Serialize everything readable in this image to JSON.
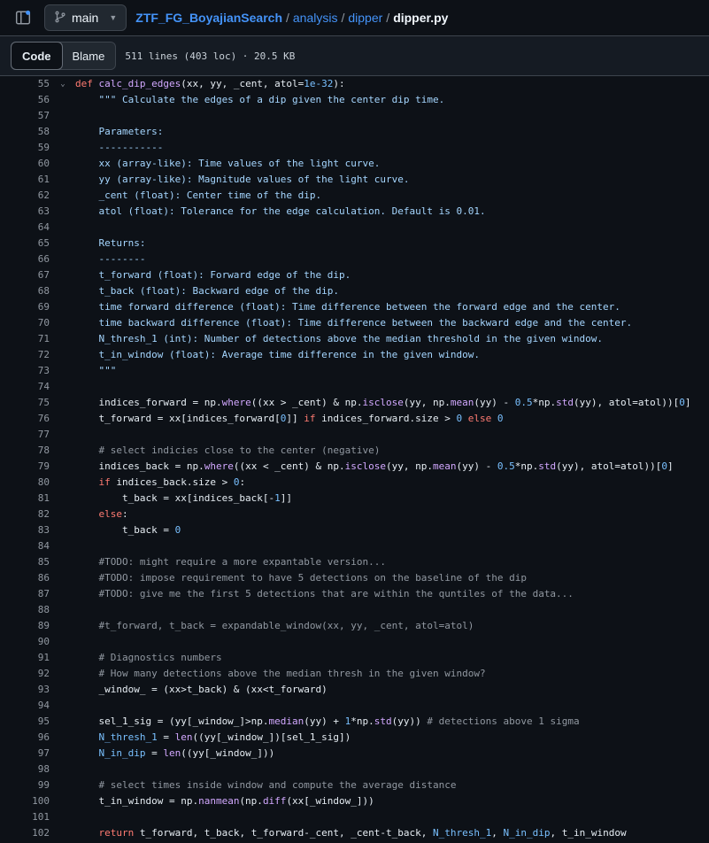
{
  "header": {
    "branch": "main",
    "repo": "ZTF_FG_BoyajianSearch",
    "path": [
      "analysis",
      "dipper"
    ],
    "file": "dipper.py"
  },
  "toolbar": {
    "code_tab": "Code",
    "blame_tab": "Blame",
    "file_info": "511 lines (403 loc) · 20.5 KB"
  },
  "code_lines": [
    {
      "n": "55",
      "t": "def calc_dip_edges(xx, yy, _cent, atol=1e-32):",
      "fold": true
    },
    {
      "n": "56",
      "t": "    \"\"\" Calculate the edges of a dip given the center dip time."
    },
    {
      "n": "57",
      "t": ""
    },
    {
      "n": "58",
      "t": "    Parameters:"
    },
    {
      "n": "59",
      "t": "    -----------"
    },
    {
      "n": "60",
      "t": "    xx (array-like): Time values of the light curve."
    },
    {
      "n": "61",
      "t": "    yy (array-like): Magnitude values of the light curve."
    },
    {
      "n": "62",
      "t": "    _cent (float): Center time of the dip."
    },
    {
      "n": "63",
      "t": "    atol (float): Tolerance for the edge calculation. Default is 0.01."
    },
    {
      "n": "64",
      "t": ""
    },
    {
      "n": "65",
      "t": "    Returns:"
    },
    {
      "n": "66",
      "t": "    --------"
    },
    {
      "n": "67",
      "t": "    t_forward (float): Forward edge of the dip."
    },
    {
      "n": "68",
      "t": "    t_back (float): Backward edge of the dip."
    },
    {
      "n": "69",
      "t": "    time forward difference (float): Time difference between the forward edge and the center."
    },
    {
      "n": "70",
      "t": "    time backward difference (float): Time difference between the backward edge and the center."
    },
    {
      "n": "71",
      "t": "    N_thresh_1 (int): Number of detections above the median threshold in the given window."
    },
    {
      "n": "72",
      "t": "    t_in_window (float): Average time difference in the given window."
    },
    {
      "n": "73",
      "t": "    \"\"\""
    },
    {
      "n": "74",
      "t": ""
    },
    {
      "n": "75",
      "t": "    indices_forward = np.where((xx > _cent) & np.isclose(yy, np.mean(yy) - 0.5*np.std(yy), atol=atol))[0]"
    },
    {
      "n": "76",
      "t": "    t_forward = xx[indices_forward[0]] if indices_forward.size > 0 else 0"
    },
    {
      "n": "77",
      "t": ""
    },
    {
      "n": "78",
      "t": "    # select indicies close to the center (negative)"
    },
    {
      "n": "79",
      "t": "    indices_back = np.where((xx < _cent) & np.isclose(yy, np.mean(yy) - 0.5*np.std(yy), atol=atol))[0]"
    },
    {
      "n": "80",
      "t": "    if indices_back.size > 0:"
    },
    {
      "n": "81",
      "t": "        t_back = xx[indices_back[-1]]"
    },
    {
      "n": "82",
      "t": "    else:"
    },
    {
      "n": "83",
      "t": "        t_back = 0"
    },
    {
      "n": "84",
      "t": ""
    },
    {
      "n": "85",
      "t": "    #TODO: might require a more expantable version..."
    },
    {
      "n": "86",
      "t": "    #TODO: impose requirement to have 5 detections on the baseline of the dip"
    },
    {
      "n": "87",
      "t": "    #TODO: give me the first 5 detections that are within the quntiles of the data..."
    },
    {
      "n": "88",
      "t": ""
    },
    {
      "n": "89",
      "t": "    #t_forward, t_back = expandable_window(xx, yy, _cent, atol=atol)"
    },
    {
      "n": "90",
      "t": ""
    },
    {
      "n": "91",
      "t": "    # Diagnostics numbers"
    },
    {
      "n": "92",
      "t": "    # How many detections above the median thresh in the given window?"
    },
    {
      "n": "93",
      "t": "    _window_ = (xx>t_back) & (xx<t_forward)"
    },
    {
      "n": "94",
      "t": ""
    },
    {
      "n": "95",
      "t": "    sel_1_sig = (yy[_window_]>np.median(yy) + 1*np.std(yy)) # detections above 1 sigma"
    },
    {
      "n": "96",
      "t": "    N_thresh_1 = len((yy[_window_])[sel_1_sig])"
    },
    {
      "n": "97",
      "t": "    N_in_dip = len((yy[_window_]))"
    },
    {
      "n": "98",
      "t": ""
    },
    {
      "n": "99",
      "t": "    # select times inside window and compute the average distance"
    },
    {
      "n": "100",
      "t": "    t_in_window = np.nanmean(np.diff(xx[_window_]))"
    },
    {
      "n": "101",
      "t": ""
    },
    {
      "n": "102",
      "t": "    return t_forward, t_back, t_forward-_cent, _cent-t_back, N_thresh_1, N_in_dip, t_in_window"
    }
  ],
  "colors": {
    "background": "#0d1117",
    "link": "#4493f8",
    "keyword": "#ff7b72",
    "function": "#d2a8ff",
    "string": "#a5d6ff",
    "number": "#79c0ff",
    "comment": "#9198a1"
  },
  "icons": {
    "sidebar_toggle": "sidebar-expand-icon",
    "branch": "git-branch-icon",
    "caret": "triangle-down-icon",
    "fold": "chevron-down-icon"
  }
}
